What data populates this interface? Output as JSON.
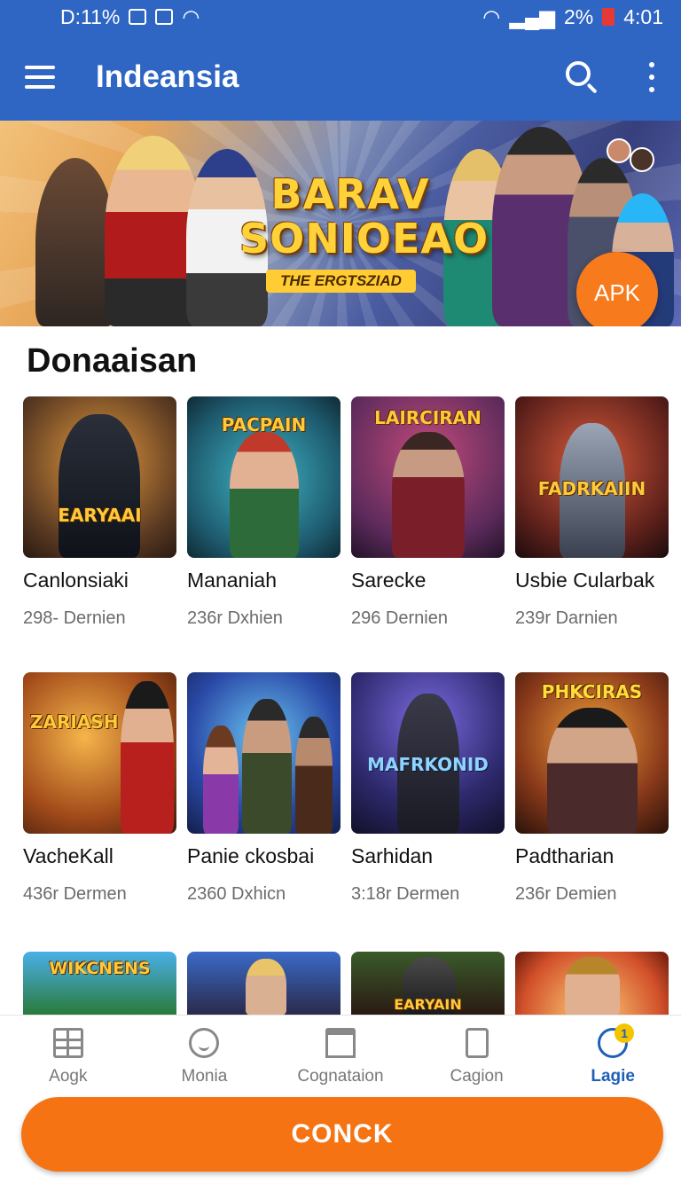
{
  "status_bar": {
    "left_text": "D:11%",
    "battery_text": "2%",
    "time": "4:01"
  },
  "app_bar": {
    "title": "Indeansia",
    "menu_icon": "hamburger-icon",
    "search_icon": "search-icon",
    "more_icon": "more-vert-icon"
  },
  "banner": {
    "title_line1": "BARAV",
    "title_line2": "SONIOEAO",
    "subtitle": "THE ERGTSZIAD",
    "apk_label": "APK"
  },
  "section": {
    "title": "Donaaisan"
  },
  "games": [
    {
      "logo": "EARYAAI",
      "name": "Canlonsiaki",
      "meta": "298- Dernien"
    },
    {
      "logo": "PACPAIN",
      "name": "Mananiah",
      "meta": "236r Dxhien"
    },
    {
      "logo": "LAIRCIRAN",
      "name": "Sarecke",
      "meta": "296 Dernien"
    },
    {
      "logo": "FADRKAIIN",
      "name": "Usbie Cularbak",
      "meta": "239r Darnien"
    },
    {
      "logo": "ZARIASH",
      "name": "VacheKall",
      "meta": "436r Dermen"
    },
    {
      "logo": "",
      "name": "Panie ckosbai",
      "meta": "2360 Dxhicn"
    },
    {
      "logo": "MAFRKONID",
      "name": "Sarhidan",
      "meta": "3:18r Dermen"
    },
    {
      "logo": "PHKCIRAS",
      "name": "Padtharian",
      "meta": "236r Demien"
    },
    {
      "logo": "WIKCNENS",
      "name": "",
      "meta": ""
    },
    {
      "logo": "",
      "name": "",
      "meta": ""
    },
    {
      "logo": "EARYAIN",
      "name": "",
      "meta": ""
    },
    {
      "logo": "",
      "name": "",
      "meta": ""
    }
  ],
  "bottom_nav": [
    {
      "label": "Aogk",
      "icon": "grid-icon"
    },
    {
      "label": "Monia",
      "icon": "smile-icon"
    },
    {
      "label": "Cognataion",
      "icon": "store-icon"
    },
    {
      "label": "Cagion",
      "icon": "device-icon"
    },
    {
      "label": "Lagie",
      "icon": "chat-icon",
      "badge": "1",
      "active": true
    }
  ],
  "cta": {
    "label": "CONCK"
  },
  "colors": {
    "primary": "#2f66c4",
    "accent": "#f57312",
    "active_nav": "#1f5fb8"
  }
}
